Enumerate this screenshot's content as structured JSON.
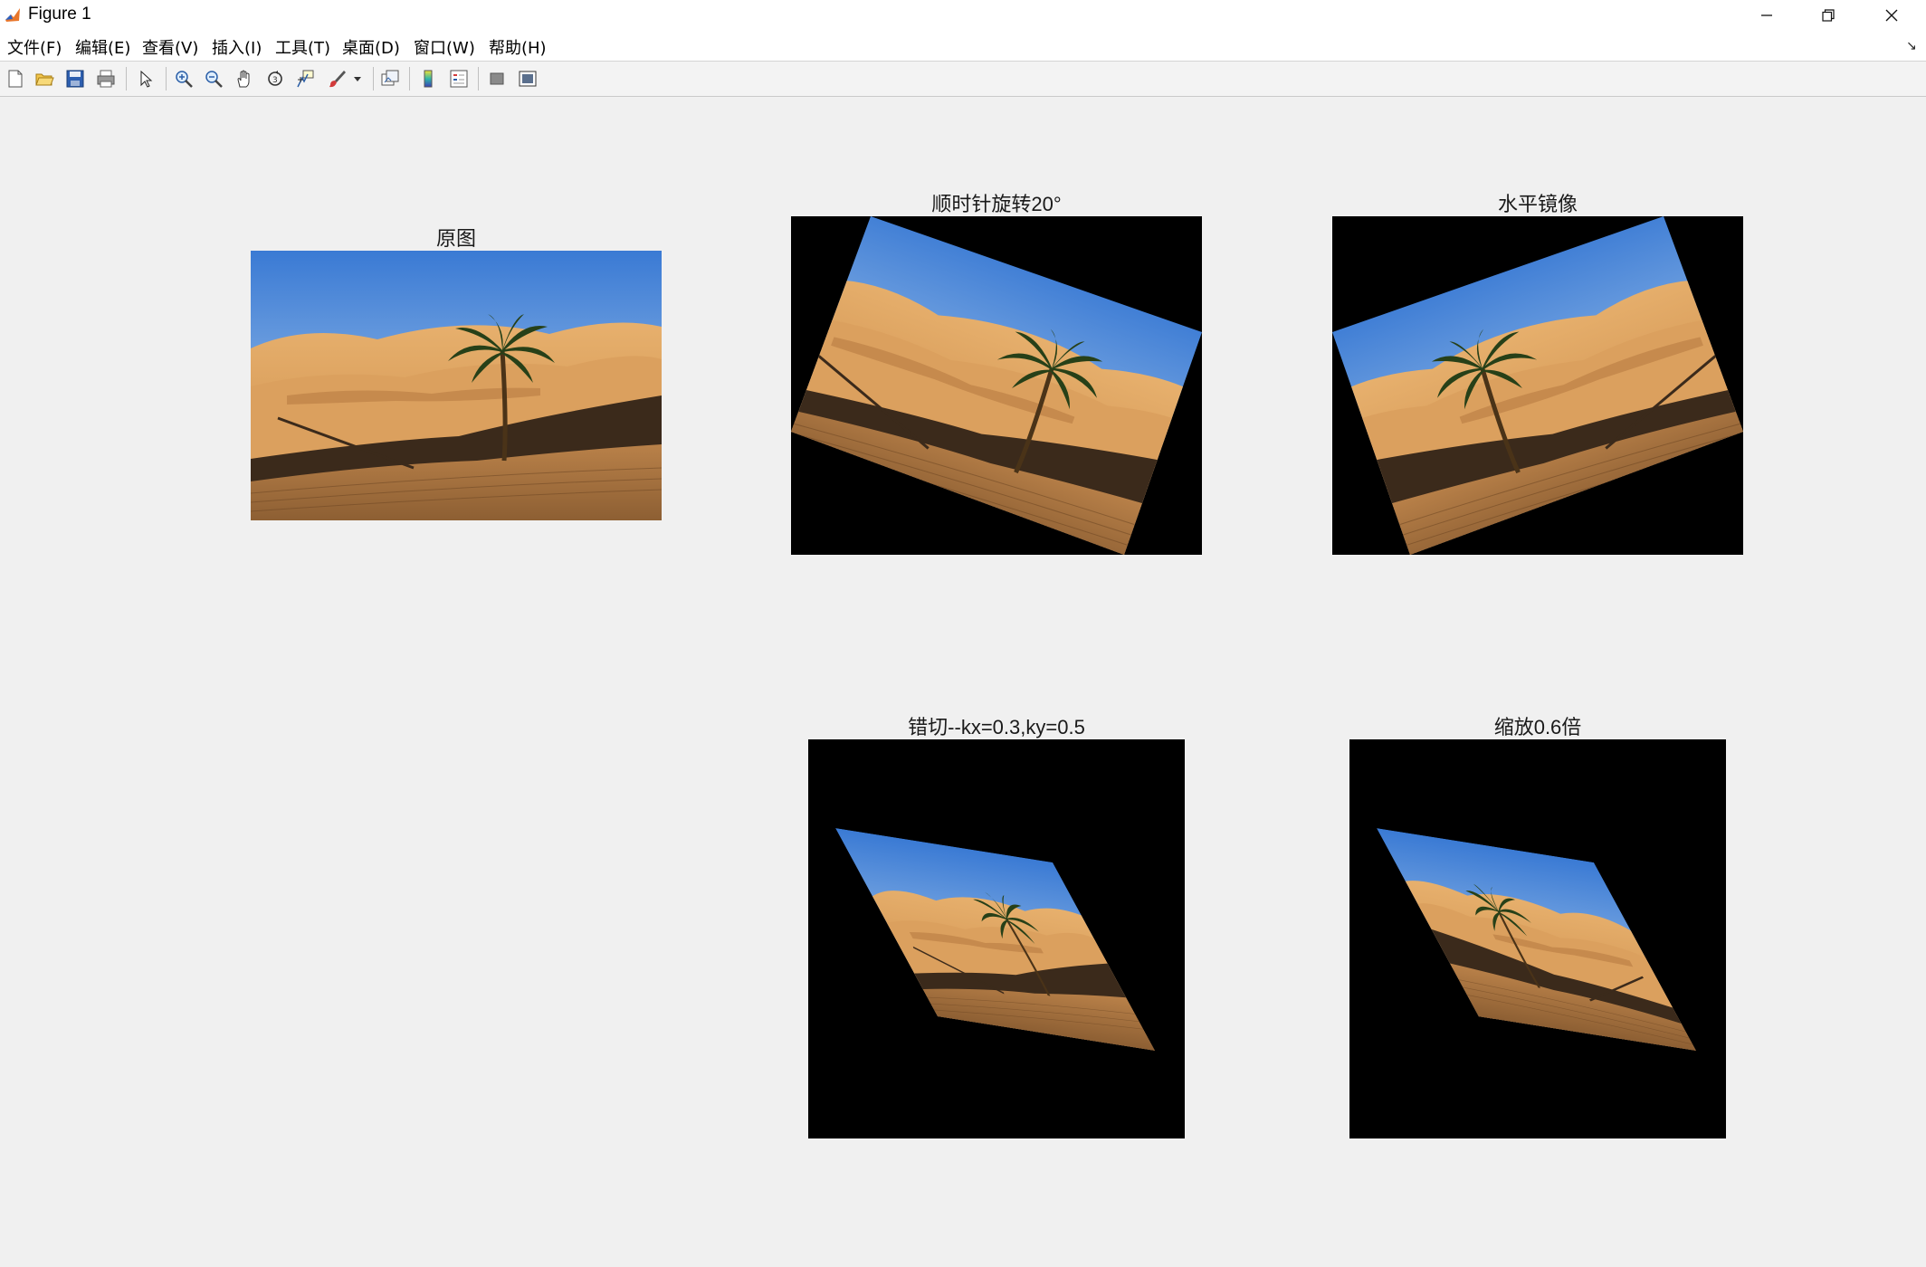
{
  "window": {
    "title": "Figure 1",
    "buttons": [
      "minimize",
      "maximize",
      "close"
    ]
  },
  "menu": [
    {
      "label": "文件(F)"
    },
    {
      "label": "编辑(E)"
    },
    {
      "label": "查看(V)"
    },
    {
      "label": "插入(I)"
    },
    {
      "label": "工具(T)"
    },
    {
      "label": "桌面(D)"
    },
    {
      "label": "窗口(W)"
    },
    {
      "label": "帮助(H)"
    }
  ],
  "toolbar": {
    "icons": [
      "new-figure-icon",
      "open-file-icon",
      "save-icon",
      "print-icon",
      "select-arrow-icon",
      "zoom-in-icon",
      "zoom-out-icon",
      "pan-hand-icon",
      "rotate-3d-icon",
      "data-cursor-icon",
      "brush-icon",
      "brush-dropdown-icon",
      "link-plot-icon",
      "insert-colorbar-icon",
      "insert-legend-icon",
      "hide-plot-tools-icon",
      "show-plot-tools-icon"
    ]
  },
  "figure": {
    "subplots": [
      {
        "title": "原图",
        "content": "desert-palm-photo",
        "transform": "none"
      },
      {
        "title": "顺时针旋转20°",
        "content": "desert-palm-photo",
        "transform": "rotate-cw-20"
      },
      {
        "title": "水平镜像",
        "content": "desert-palm-photo",
        "transform": "rotate-cw-20-mirrored"
      },
      {
        "title": "错切--kx=0.3,ky=0.5",
        "content": "desert-palm-photo",
        "transform": "shear"
      },
      {
        "title": "缩放0.6倍",
        "content": "desert-palm-photo",
        "transform": "shear-mirrored-scaled"
      }
    ]
  },
  "colors": {
    "sky_top": "#3d7fd6",
    "sky_bottom": "#b8d4ef",
    "sand_light": "#e0a35c",
    "sand_dark": "#8a5a2c",
    "shadow": "#3a2a1c",
    "axes_bg": "#000000"
  }
}
